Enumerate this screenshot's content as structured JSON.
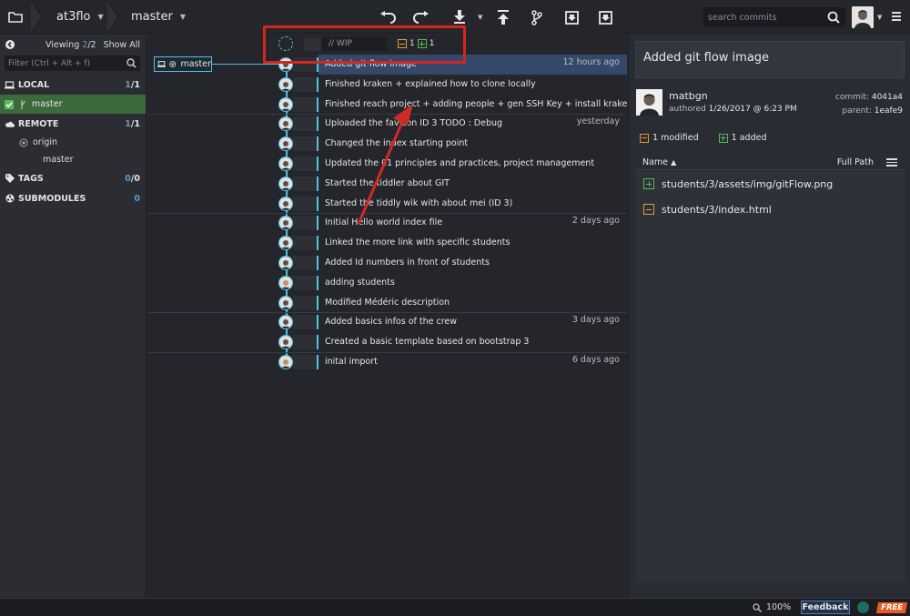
{
  "topbar": {
    "repo_name": "at3flo",
    "branch_name": "master",
    "search_placeholder": "search commits",
    "toolbar_icons": [
      "undo-icon",
      "redo-icon",
      "pull-icon",
      "push-icon",
      "branch-icon",
      "stash-icon",
      "pop-icon"
    ]
  },
  "left": {
    "viewing_label": "Viewing",
    "viewing_count": "2",
    "viewing_total": "/2",
    "show_all": "Show All",
    "filter_placeholder": "Filter (Ctrl + Alt + f)",
    "local": {
      "label": "LOCAL",
      "count_a": "1",
      "count_b": "/1",
      "branch": "master"
    },
    "remote": {
      "label": "REMOTE",
      "count_a": "1",
      "count_b": "/1",
      "origin": "origin",
      "branch": "master"
    },
    "tags": {
      "label": "TAGS",
      "count_a": "0",
      "count_b": "/0"
    },
    "submodules": {
      "label": "SUBMODULES",
      "count": "0"
    }
  },
  "graph": {
    "wip_text": "// WIP",
    "wip_modified": "1",
    "wip_added": "1",
    "branch_label": "master",
    "commits": [
      {
        "message": "Added git flow image",
        "time": "12 hours ago"
      },
      {
        "message": "Finished kraken + explained how to clone locally",
        "time": ""
      },
      {
        "message": "Finished reach project + adding people + gen SSH Key + install kraken",
        "time": ""
      },
      {
        "message": "Uploaded the favicon ID 3 TODO : Debug",
        "time": "yesterday"
      },
      {
        "message": "Changed the index starting point",
        "time": ""
      },
      {
        "message": "Updated the 01 principles and practices, project management",
        "time": ""
      },
      {
        "message": "Started the tiddler about GIT",
        "time": ""
      },
      {
        "message": "Started the tiddly wik with about mei (ID 3)",
        "time": ""
      },
      {
        "message": "Initial Hello world index file",
        "time": "2 days ago"
      },
      {
        "message": "Linked the more link with specific students",
        "time": ""
      },
      {
        "message": "Added Id numbers in front of students",
        "time": ""
      },
      {
        "message": "adding students",
        "time": ""
      },
      {
        "message": "Modified Médéric description",
        "time": ""
      },
      {
        "message": "Added basics infos of the crew",
        "time": "3 days ago"
      },
      {
        "message": "Created a basic template based on bootstrap 3",
        "time": ""
      },
      {
        "message": "inital import",
        "time": "6 days ago"
      }
    ]
  },
  "right": {
    "title": "Added git flow image",
    "author": "matbgn",
    "authored_label": "authored",
    "authored_date": "1/26/2017 @ 6:23 PM",
    "commit_label": "commit:",
    "commit_sha": "4041a4",
    "parent_label": "parent:",
    "parent_sha": "1eafe9",
    "modified_text": "1 modified",
    "added_text": "1 added",
    "name_col": "Name",
    "full_path": "Full Path",
    "files": [
      {
        "path": "students/3/assets/img/gitFlow.png",
        "status": "added"
      },
      {
        "path": "students/3/index.html",
        "status": "modified"
      }
    ]
  },
  "status": {
    "zoom": "100%",
    "feedback": "Feedback",
    "free": "FREE"
  },
  "colors": {
    "accent": "#4cc3e0",
    "highlight": "#d8231f",
    "added": "#5cb85c",
    "modified": "#e09a3c",
    "selected_row": "#34496a"
  }
}
